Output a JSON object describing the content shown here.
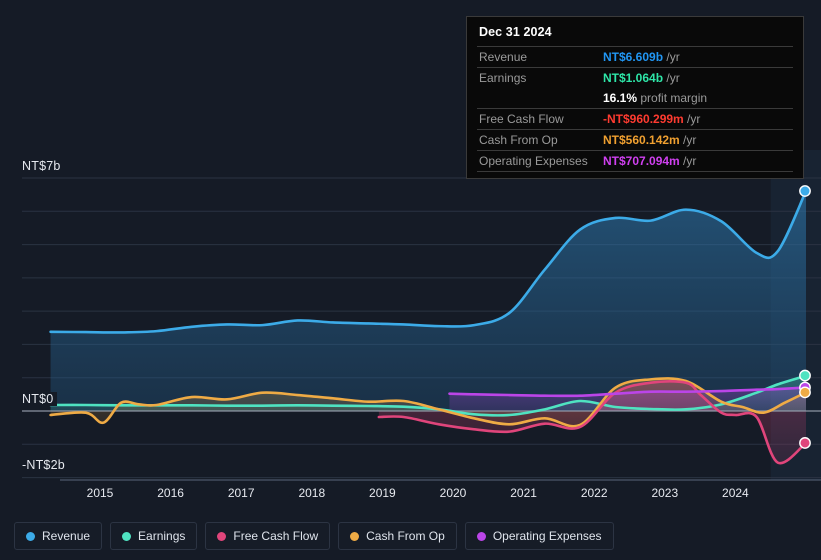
{
  "colors": {
    "background": "#151b26",
    "revenue": "#3cabe8",
    "earnings": "#4fe3c1",
    "free_cash_flow": "#e0457b",
    "cash_from_op": "#efab45",
    "operating_expenses": "#bb45e8",
    "tooltip_bg": "#090909",
    "tooltip_border": "#3a3a3a",
    "tooltip_revenue": "#2196f3",
    "tooltip_earnings": "#2ee6a8",
    "tooltip_fcf": "#ff3b30",
    "tooltip_cfo": "#f0a030",
    "tooltip_opex": "#d040f0",
    "grid": "#2a3342",
    "zero_line": "#9aa3b0",
    "axis_text": "#e6e9ef"
  },
  "tooltip": {
    "date": "Dec 31 2024",
    "rows": [
      {
        "label": "Revenue",
        "value": "NT$6.609b",
        "unit": "/yr",
        "color_key": "tooltip_revenue"
      },
      {
        "label": "Earnings",
        "value": "NT$1.064b",
        "unit": "/yr",
        "color_key": "tooltip_earnings"
      },
      {
        "label": "",
        "value": "16.1%",
        "unit": "profit margin",
        "color_key": "white"
      },
      {
        "label": "Free Cash Flow",
        "value": "-NT$960.299m",
        "unit": "/yr",
        "color_key": "tooltip_fcf"
      },
      {
        "label": "Cash From Op",
        "value": "NT$560.142m",
        "unit": "/yr",
        "color_key": "tooltip_cfo"
      },
      {
        "label": "Operating Expenses",
        "value": "NT$707.094m",
        "unit": "/yr",
        "color_key": "tooltip_opex"
      }
    ]
  },
  "legend": {
    "items": [
      {
        "label": "Revenue",
        "color_key": "revenue"
      },
      {
        "label": "Earnings",
        "color_key": "earnings"
      },
      {
        "label": "Free Cash Flow",
        "color_key": "free_cash_flow"
      },
      {
        "label": "Cash From Op",
        "color_key": "cash_from_op"
      },
      {
        "label": "Operating Expenses",
        "color_key": "operating_expenses"
      }
    ]
  },
  "chart_data": {
    "type": "line",
    "title": "",
    "xlabel": "",
    "ylabel": "",
    "grid": true,
    "legend_position": "bottom",
    "currency": "NT$",
    "y_ticks": [
      {
        "label": "NT$7b",
        "value": 7
      },
      {
        "label": "NT$0",
        "value": 0
      },
      {
        "label": "-NT$2b",
        "value": -2
      }
    ],
    "ylim": [
      -2.5,
      7.5
    ],
    "x_ticks": [
      "2015",
      "2016",
      "2017",
      "2018",
      "2019",
      "2020",
      "2021",
      "2022",
      "2023",
      "2024"
    ],
    "xlim": [
      2014.3,
      2025.0
    ],
    "forecast_band_start": 2024.5,
    "series": [
      {
        "name": "Revenue",
        "color_key": "revenue",
        "x": [
          2014.3,
          2014.8,
          2015.3,
          2015.8,
          2016.3,
          2016.8,
          2017.3,
          2017.8,
          2018.3,
          2018.8,
          2019.3,
          2019.8,
          2020.3,
          2020.8,
          2021.3,
          2021.8,
          2022.3,
          2022.8,
          2023.3,
          2023.8,
          2024.3,
          2024.6,
          2025.0
        ],
        "values": [
          2.38,
          2.37,
          2.36,
          2.4,
          2.53,
          2.6,
          2.58,
          2.72,
          2.66,
          2.63,
          2.6,
          2.55,
          2.58,
          2.95,
          4.25,
          5.45,
          5.8,
          5.72,
          6.05,
          5.7,
          4.75,
          4.8,
          6.61
        ]
      },
      {
        "name": "Earnings",
        "color_key": "earnings",
        "x": [
          2014.3,
          2014.8,
          2015.3,
          2015.8,
          2016.3,
          2016.8,
          2017.3,
          2017.8,
          2018.3,
          2018.8,
          2019.3,
          2019.8,
          2020.3,
          2020.8,
          2021.3,
          2021.8,
          2022.3,
          2022.8,
          2023.3,
          2023.8,
          2024.3,
          2024.6,
          2025.0
        ],
        "values": [
          0.18,
          0.18,
          0.17,
          0.17,
          0.17,
          0.16,
          0.16,
          0.17,
          0.16,
          0.15,
          0.13,
          0.05,
          -0.1,
          -0.12,
          0.05,
          0.3,
          0.12,
          0.06,
          0.05,
          0.2,
          0.55,
          0.8,
          1.06
        ]
      },
      {
        "name": "Free Cash Flow",
        "color_key": "free_cash_flow",
        "x": [
          2018.95,
          2019.3,
          2019.8,
          2020.3,
          2020.8,
          2021.3,
          2021.8,
          2022.3,
          2022.8,
          2023.3,
          2023.5,
          2023.8,
          2024.0,
          2024.3,
          2024.6,
          2025.0
        ],
        "values": [
          -0.18,
          -0.18,
          -0.4,
          -0.55,
          -0.62,
          -0.38,
          -0.48,
          0.55,
          0.85,
          0.85,
          0.5,
          -0.05,
          -0.12,
          -0.18,
          -1.55,
          -0.96
        ]
      },
      {
        "name": "Cash From Op",
        "color_key": "cash_from_op",
        "x": [
          2014.3,
          2014.8,
          2015.05,
          2015.3,
          2015.55,
          2015.8,
          2016.3,
          2016.8,
          2017.3,
          2017.8,
          2018.3,
          2018.8,
          2019.3,
          2019.8,
          2020.3,
          2020.8,
          2021.3,
          2021.8,
          2022.3,
          2022.8,
          2023.3,
          2023.8,
          2024.1,
          2024.4,
          2024.7,
          2025.0
        ],
        "values": [
          -0.12,
          -0.05,
          -0.35,
          0.25,
          0.2,
          0.18,
          0.42,
          0.35,
          0.55,
          0.48,
          0.38,
          0.28,
          0.3,
          0.05,
          -0.22,
          -0.4,
          -0.22,
          -0.42,
          0.7,
          0.95,
          0.9,
          0.28,
          0.12,
          -0.05,
          0.25,
          0.56
        ]
      },
      {
        "name": "Operating Expenses",
        "color_key": "operating_expenses",
        "x": [
          2019.95,
          2020.3,
          2020.8,
          2021.3,
          2021.8,
          2022.3,
          2022.8,
          2023.3,
          2023.8,
          2024.3,
          2024.6,
          2025.0
        ],
        "values": [
          0.52,
          0.5,
          0.48,
          0.46,
          0.46,
          0.52,
          0.58,
          0.58,
          0.6,
          0.64,
          0.66,
          0.707
        ]
      }
    ],
    "end_markers": [
      {
        "series": "Revenue",
        "value": 6.609,
        "color_key": "revenue"
      },
      {
        "series": "Earnings",
        "value": 1.064,
        "color_key": "earnings"
      },
      {
        "series": "Operating Expenses",
        "value": 0.707,
        "color_key": "operating_expenses"
      },
      {
        "series": "Cash From Op",
        "value": 0.56,
        "color_key": "cash_from_op"
      },
      {
        "series": "Free Cash Flow",
        "value": -0.96,
        "color_key": "free_cash_flow"
      }
    ]
  }
}
